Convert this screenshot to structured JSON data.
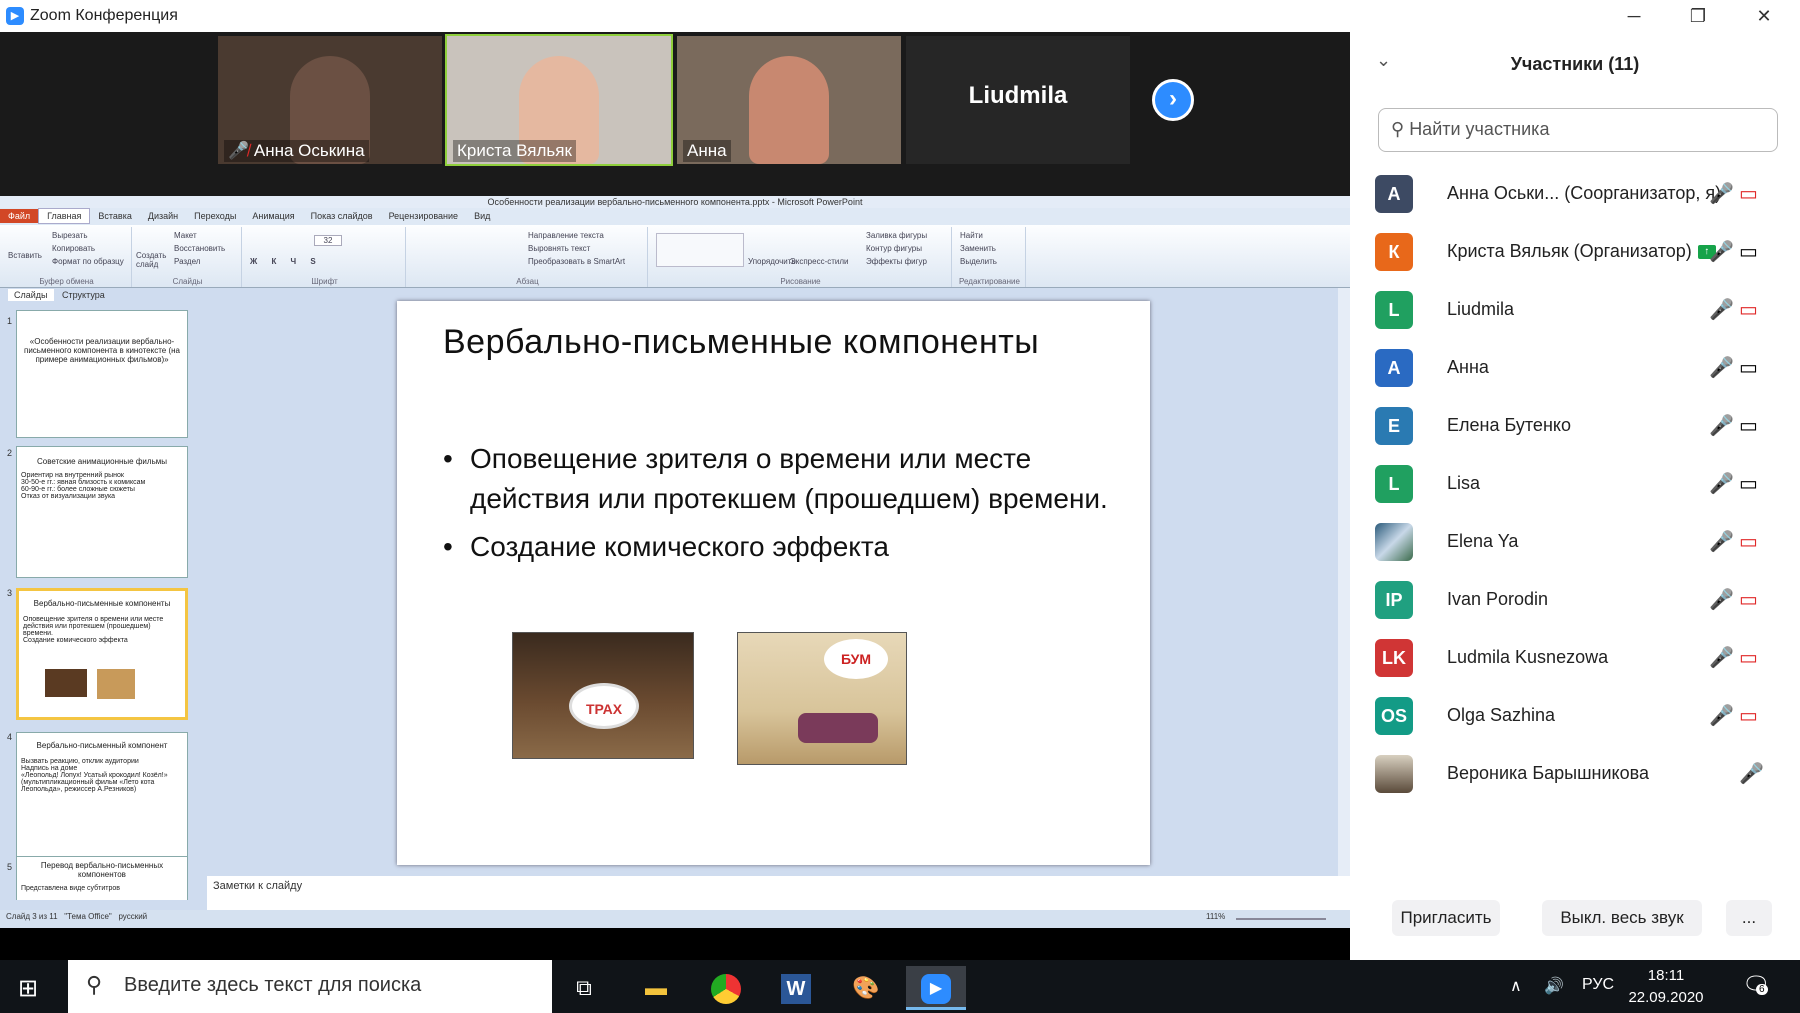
{
  "window": {
    "title": "Zoom Конференция",
    "minimize": "─",
    "restore": "❐",
    "close": "✕"
  },
  "gallery": {
    "tiles": [
      {
        "name": "Анна Оськина",
        "muted": true,
        "face_color": "#6b5043",
        "bg": "#4a3a30"
      },
      {
        "name": "Криста Вяльяк",
        "muted": false,
        "face_color": "#e5b8a0",
        "bg": "#c9c3bc"
      },
      {
        "name": "Анна",
        "muted": false,
        "face_color": "#c88870",
        "bg": "#7a6a5c"
      },
      {
        "name": "Liudmila",
        "muted": false,
        "face_color": "",
        "bg": "#262626"
      }
    ],
    "next_icon": "›"
  },
  "ppt": {
    "title": "Особенности реализации вербально-письменного компонента.pptx - Microsoft PowerPoint",
    "tabs": [
      "Файл",
      "Главная",
      "Вставка",
      "Дизайн",
      "Переходы",
      "Анимация",
      "Показ слайдов",
      "Рецензирование",
      "Вид"
    ],
    "ribbon": {
      "clipboard": {
        "label": "Буфер обмена",
        "paste": "Вставить",
        "cut": "Вырезать",
        "copy": "Копировать",
        "format": "Формат по образцу"
      },
      "slides": {
        "label": "Слайды",
        "create": "Создать слайд",
        "layout": "Макет",
        "reset": "Восстановить",
        "section": "Раздел"
      },
      "font": {
        "label": "Шрифт",
        "size": "32"
      },
      "paragraph": {
        "label": "Абзац",
        "direction": "Направление текста",
        "align": "Выровнять текст",
        "smartart": "Преобразовать в SmartArt"
      },
      "drawing": {
        "label": "Рисование",
        "arrange": "Упорядочить",
        "styles": "Экспресс-стили",
        "fill": "Заливка фигуры",
        "outline": "Контур фигуры",
        "effects": "Эффекты фигур"
      },
      "editing": {
        "label": "Редактирование",
        "find": "Найти",
        "replace": "Заменить",
        "select": "Выделить"
      }
    },
    "left_tabs": [
      "Слайды",
      "Структура"
    ],
    "thumbs": [
      {
        "num": "1",
        "title": "«Особенности реализации вербально-письменного компонента в кинотексте (на примере анимационных фильмов)»",
        "bullets": []
      },
      {
        "num": "2",
        "title": "Советские анимационные фильмы",
        "bullets": [
          "Ориентир на внутренний рынок",
          "30-50-е гг.: явная близость к комиксам",
          "60-90-е гг.: более сложные сюжеты",
          "Отказ от визуализации звука",
          ""
        ]
      },
      {
        "num": "3",
        "title": "Вербально-письменные компоненты",
        "bullets": [
          "Оповещение зрителя о времени или месте действия или протекшем (прошедшем) времени.",
          "Создание комического эффекта"
        ]
      },
      {
        "num": "4",
        "title": "Вербально-письменный компонент",
        "bullets": [
          "Вызвать реакцию, отклик аудитории",
          "Надпись на доме",
          "«Леопольд! Лопух! Усатый крокодил! Козёл!» (мультипликационный фильм «Лето кота Леопольда», режиссер А.Резников)"
        ]
      },
      {
        "num": "5",
        "title": "Перевод вербально-письменных компонентов",
        "bullets": [
          "Представлена виде субтитров"
        ]
      }
    ],
    "slide": {
      "title": "Вербально-письменные компоненты",
      "bullets": [
        "Оповещение зрителя о времени или месте действия или протекшем (прошедшем) времени.",
        "Создание комического эффекта"
      ],
      "img1": "ТРАХ",
      "img2": "БУМ"
    },
    "notes": "Заметки к слайду",
    "status": {
      "slide": "Слайд 3 из 11",
      "theme": "\"Тема Office\"",
      "lang": "русский",
      "zoom": "111%"
    }
  },
  "panel": {
    "title": "Участники (11)",
    "search_placeholder": "Найти участника",
    "participants": [
      {
        "initials": "А",
        "color": "#3d4a63",
        "name": "Анна Оськи...  (Соорганизатор, я)",
        "mic": "muted",
        "cam": "off"
      },
      {
        "initials": "К",
        "color": "#e8681a",
        "name": "Криста Вяльяк (Организатор)",
        "share": true,
        "mic": "on",
        "cam": "on"
      },
      {
        "initials": "L",
        "color": "#20a060",
        "name": "Liudmila",
        "mic": "on",
        "cam": "off"
      },
      {
        "initials": "А",
        "color": "#2a6ac2",
        "name": "Анна",
        "mic": "on",
        "cam": "on"
      },
      {
        "initials": "Е",
        "color": "#2a7ab2",
        "name": "Елена Бутенко",
        "mic": "on",
        "cam": "on"
      },
      {
        "initials": "L",
        "color": "#20a060",
        "name": "Lisa",
        "mic": "on",
        "cam": "on"
      },
      {
        "initials": "",
        "color": "#5a7a90",
        "name": "Elena Ya",
        "mic": "muted",
        "cam": "off"
      },
      {
        "initials": "IP",
        "color": "#20a080",
        "name": "Ivan Porodin",
        "mic": "muted",
        "cam": "off"
      },
      {
        "initials": "LK",
        "color": "#d03535",
        "name": "Ludmila Kusnezowa",
        "mic": "muted",
        "cam": "off"
      },
      {
        "initials": "OS",
        "color": "#139b86",
        "name": "Olga Sazhina",
        "mic": "muted",
        "cam": "off"
      },
      {
        "initials": "",
        "color": "#8a9a8a",
        "name": "Вероника Барышникова",
        "mic": "",
        "cam": "muted-only"
      }
    ],
    "invite": "Пригласить",
    "mute_all": "Выкл. весь звук",
    "more": "..."
  },
  "taskbar": {
    "search_placeholder": "Введите здесь текст для поиска",
    "lang": "РУС",
    "time": "18:11",
    "date": "22.09.2020",
    "notifications": "6"
  }
}
